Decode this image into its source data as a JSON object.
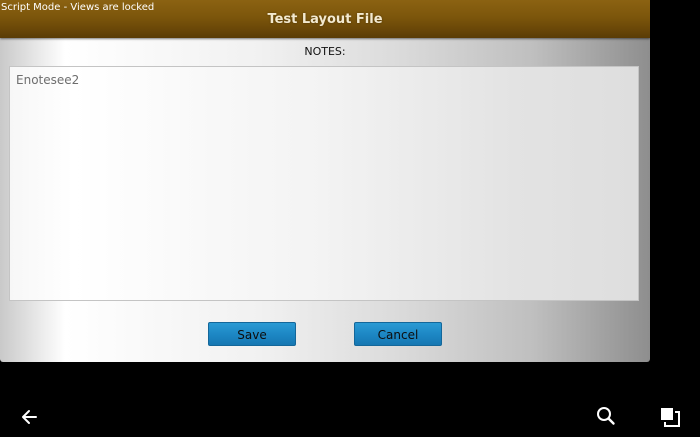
{
  "status_bar": {
    "text": "Script Mode - Views are locked"
  },
  "dialog": {
    "title": "Test Layout File",
    "notes_label": "NOTES:",
    "notes_value": "Enotesee2",
    "save_label": "Save",
    "cancel_label": "Cancel"
  },
  "colors": {
    "title_bar": "#7c560b",
    "button": "#1c86c3",
    "background": "#000000"
  },
  "nav": {
    "icons": [
      "back-arrow-icon",
      "search-icon",
      "recent-apps-icon"
    ]
  }
}
